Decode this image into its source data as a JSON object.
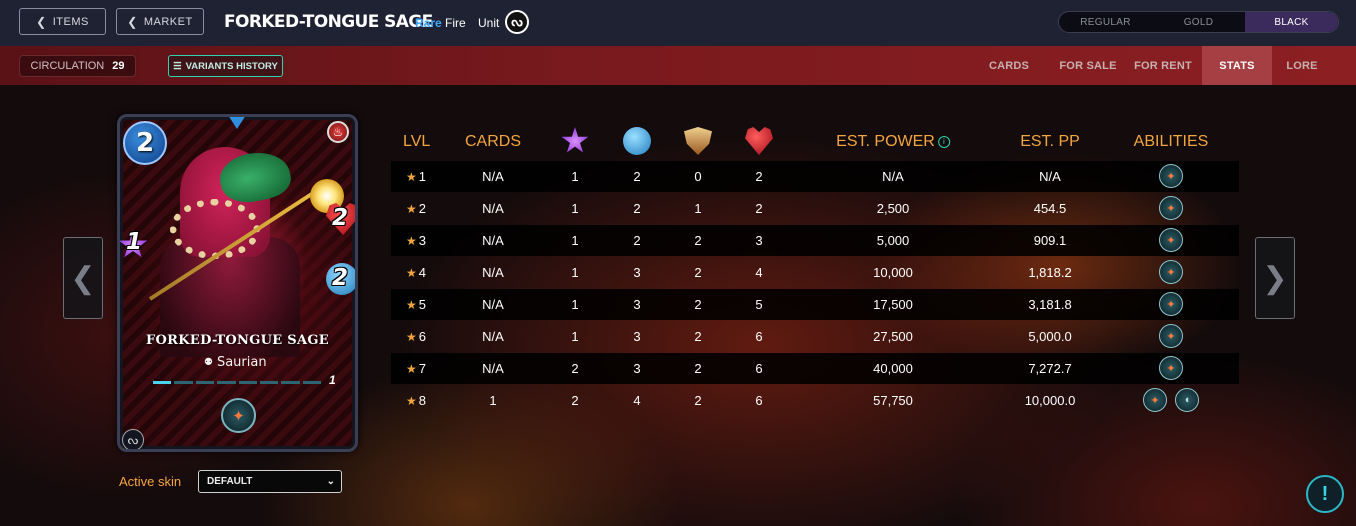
{
  "header": {
    "items_btn": "ITEMS",
    "market_btn": "MARKET",
    "card_name": "FORKED-TONGUE SAGE",
    "rarity": "Rare",
    "element": "Fire",
    "card_type": "Unit",
    "foils": [
      "REGULAR",
      "GOLD",
      "BLACK"
    ],
    "active_foil": "BLACK"
  },
  "subbar": {
    "circulation_label": "CIRCULATION",
    "circulation_value": "29",
    "variants_label": "VARIANTS HISTORY",
    "tabs": [
      "CARDS",
      "FOR SALE",
      "FOR RENT",
      "STATS",
      "LORE"
    ],
    "active_tab": "STATS"
  },
  "card": {
    "mana": "2",
    "attack_magic": "1",
    "health": "2",
    "speed": "2",
    "name": "FORKED-TONGUE SAGE",
    "tribe": "Saurian",
    "level": "1",
    "level_fraction": 0.125
  },
  "skin": {
    "label": "Active skin",
    "selected": "DEFAULT"
  },
  "table": {
    "headers": {
      "lvl": "LVL",
      "cards": "CARDS",
      "est_power": "EST. POWER",
      "est_pp": "EST. PP",
      "abilities": "ABILITIES"
    },
    "stat_icons": [
      "magic-attack-icon",
      "speed-icon",
      "armor-icon",
      "health-icon"
    ],
    "rows": [
      {
        "lvl": "1",
        "cards": "N/A",
        "magic": "1",
        "speed": "2",
        "armor": "0",
        "health": "2",
        "power": "N/A",
        "pp": "N/A",
        "abilities": 1
      },
      {
        "lvl": "2",
        "cards": "N/A",
        "magic": "1",
        "speed": "2",
        "armor": "1",
        "health": "2",
        "power": "2,500",
        "pp": "454.5",
        "abilities": 1
      },
      {
        "lvl": "3",
        "cards": "N/A",
        "magic": "1",
        "speed": "2",
        "armor": "2",
        "health": "3",
        "power": "5,000",
        "pp": "909.1",
        "abilities": 1
      },
      {
        "lvl": "4",
        "cards": "N/A",
        "magic": "1",
        "speed": "3",
        "armor": "2",
        "health": "4",
        "power": "10,000",
        "pp": "1,818.2",
        "abilities": 1
      },
      {
        "lvl": "5",
        "cards": "N/A",
        "magic": "1",
        "speed": "3",
        "armor": "2",
        "health": "5",
        "power": "17,500",
        "pp": "3,181.8",
        "abilities": 1
      },
      {
        "lvl": "6",
        "cards": "N/A",
        "magic": "1",
        "speed": "3",
        "armor": "2",
        "health": "6",
        "power": "27,500",
        "pp": "5,000.0",
        "abilities": 1
      },
      {
        "lvl": "7",
        "cards": "N/A",
        "magic": "2",
        "speed": "3",
        "armor": "2",
        "health": "6",
        "power": "40,000",
        "pp": "7,272.7",
        "abilities": 1
      },
      {
        "lvl": "8",
        "cards": "1",
        "magic": "2",
        "speed": "4",
        "armor": "2",
        "health": "6",
        "power": "57,750",
        "pp": "10,000.0",
        "abilities": 2
      }
    ]
  },
  "help_label": "!",
  "colors": {
    "accent_orange": "#f2a640",
    "teal": "#2fd3b0",
    "rarity_blue": "#3fa8ff",
    "subbar_red": "#8c1f22"
  }
}
